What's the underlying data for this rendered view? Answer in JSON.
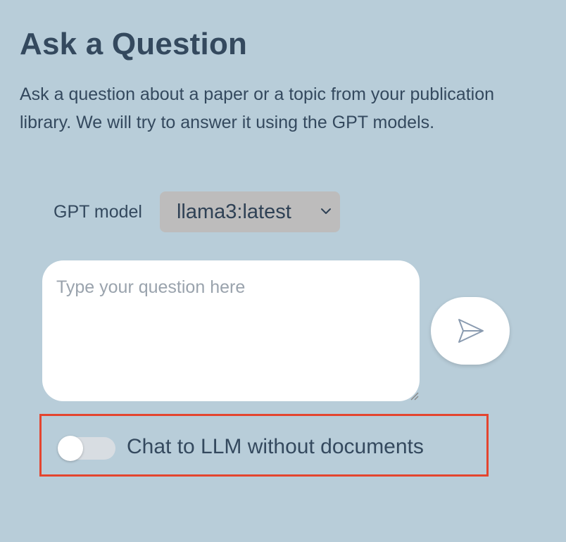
{
  "header": {
    "title": "Ask a Question",
    "description": "Ask a question about a paper or a topic from your publication library. We will try to answer it using the GPT models."
  },
  "model": {
    "label": "GPT model",
    "selected": "llama3:latest"
  },
  "question": {
    "placeholder": "Type your question here",
    "value": ""
  },
  "send": {
    "icon": "send-icon"
  },
  "toggle": {
    "label": "Chat to LLM without documents",
    "checked": false
  },
  "colors": {
    "background": "#b8cdd9",
    "text": "#34495e",
    "highlight": "#e4452f",
    "select_bg": "#bdbcbc"
  }
}
